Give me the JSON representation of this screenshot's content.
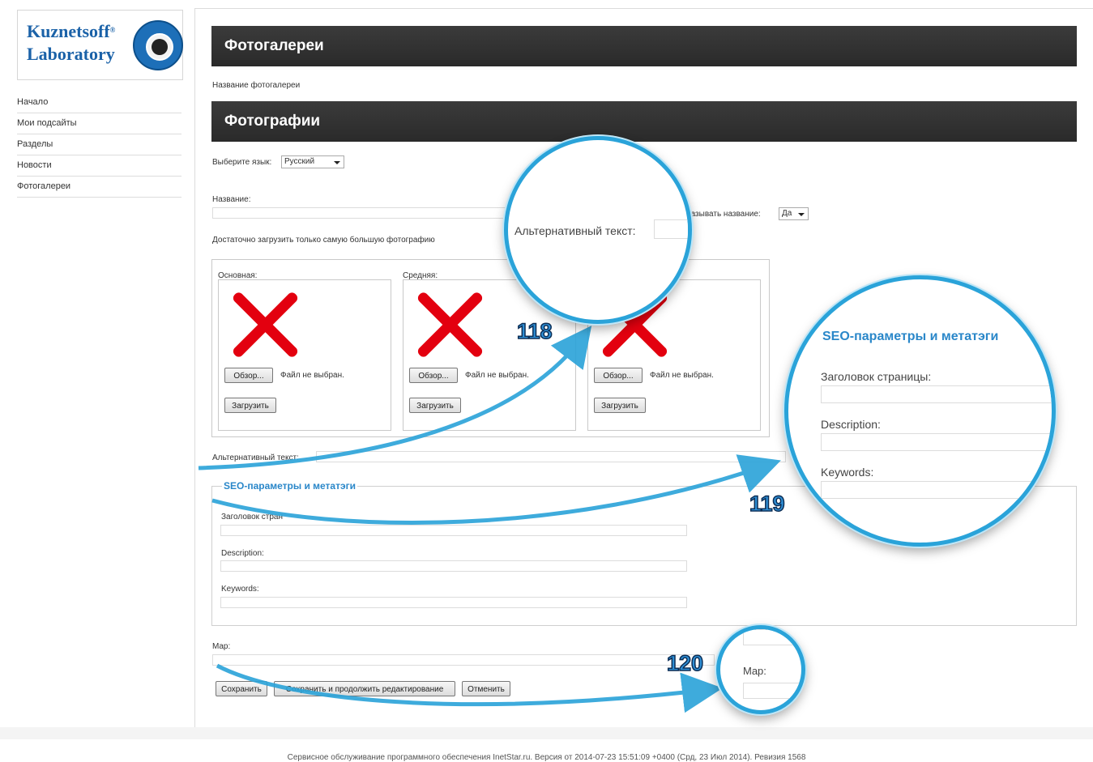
{
  "logo": {
    "line1": "Kuznetsoff",
    "line2": "Laboratory",
    "mark": "®"
  },
  "nav": {
    "items": [
      "Начало",
      "Мои подсайты",
      "Разделы",
      "Новости",
      "Фотогалереи"
    ]
  },
  "sections": {
    "galleries_title": "Фотогалереи",
    "gallery_name_label": "Название фотогалереи",
    "photos_title": "Фотографии"
  },
  "lang": {
    "label": "Выберите язык:",
    "value": "Русский"
  },
  "name_field": {
    "label": "Название:"
  },
  "show_name": {
    "label": "Показывать название:",
    "visible_part": "казывать название:",
    "value": "Да"
  },
  "hint": "Достаточно загрузить только самую большую фотографию",
  "photos": {
    "main_label": "Основная:",
    "medium_label": "Средняя:",
    "browse_label": "Обзор...",
    "no_file": "Файл не выбран.",
    "upload_label": "Загрузить"
  },
  "alt_text": {
    "label": "Альтернативный текст:"
  },
  "seo": {
    "legend": "SEO-параметры и метатэги",
    "title_label": "Заголовок страницы:",
    "title_visible": "Заголовок стран",
    "description_label": "Description:",
    "keywords_label": "Keywords:"
  },
  "map": {
    "label": "Map:"
  },
  "actions": {
    "save": "Сохранить",
    "save_continue": "Сохранить и продолжить редактирование",
    "cancel": "Отменить"
  },
  "callouts": {
    "first": "118",
    "second": "119",
    "third": "120"
  },
  "footer": "Сервисное обслуживание программного обеспечения InetStar.ru. Версия от 2014-07-23 15:51:09 +0400 (Срд, 23 Июл 2014). Ревизия 1568",
  "colors": {
    "header_bg": "#333333",
    "accent": "#2aa3d9",
    "legend_blue": "#2a87c9",
    "x_red": "#e3000f",
    "brand_blue": "#1b62a8"
  }
}
